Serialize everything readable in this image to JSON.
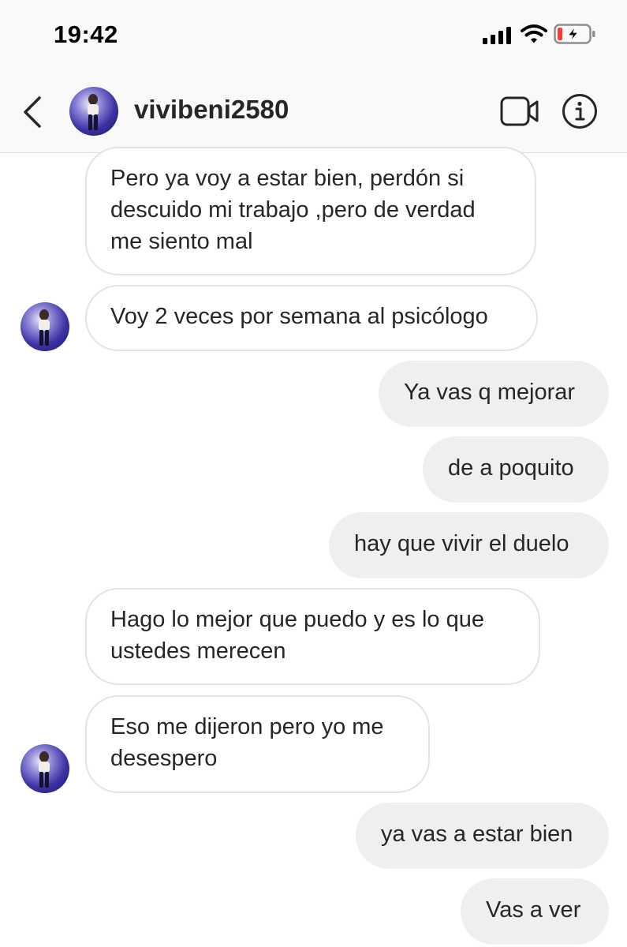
{
  "status_bar": {
    "time": "19:42",
    "icons": [
      "cellular-signal-icon",
      "wifi-icon",
      "battery-charging-icon"
    ]
  },
  "header": {
    "username": "vivibeni2580",
    "icons": [
      "back-chevron-icon",
      "video-call-icon",
      "info-icon"
    ]
  },
  "messages": [
    {
      "direction": "received",
      "text": "Pero ya voy a estar bien, perdón si\ndescuido mi trabajo ,pero de verdad\nme siento mal"
    },
    {
      "direction": "received",
      "text": "Voy 2 veces por semana al psicólogo"
    },
    {
      "direction": "sent",
      "text": "Ya vas q mejorar"
    },
    {
      "direction": "sent",
      "text": "de a poquito"
    },
    {
      "direction": "sent",
      "text": "hay que vivir el duelo"
    },
    {
      "direction": "received",
      "text": "Hago lo mejor que puedo y es lo que\nustedes merecen"
    },
    {
      "direction": "received",
      "text": "Eso me dijeron pero yo me\ndesespero"
    },
    {
      "direction": "sent",
      "text": "ya vas a estar bien"
    },
    {
      "direction": "sent",
      "text": "Vas a ver"
    }
  ],
  "colors": {
    "sent_bubble": "#efefef",
    "received_border": "#e3e3e3",
    "battery_low": "#ff3b30"
  }
}
